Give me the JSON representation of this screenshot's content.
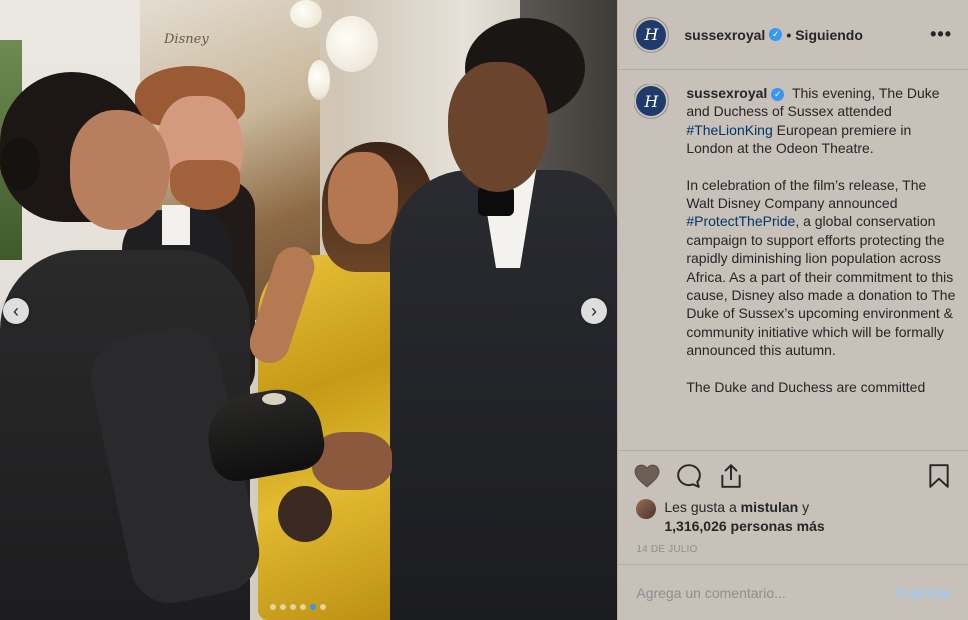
{
  "post": {
    "username": "sussexroyal",
    "follow_separator": "•",
    "follow_status": "Siguiendo",
    "more_label": "•••",
    "avatar_monogram": "H",
    "photo": {
      "poster_text": "Disney",
      "carousel_dots": 6,
      "carousel_active_index": 4,
      "prev_icon": "‹",
      "next_icon": "›"
    },
    "caption": {
      "username": "sussexroyal",
      "para1_before": " This evening, The Duke and Duchess of Sussex attended ",
      "hashtag1": "#TheLionKing",
      "para1_after": " European premiere in London at the Odeon Theatre.",
      "para2_before": "In celebration of the film’s release, The Walt Disney Company announced ",
      "hashtag2": "#ProtectThePride",
      "para2_after": ", a global conservation campaign to support efforts protecting the rapidly diminishing lion population across Africa. As a part of their commitment to this cause, Disney also made a donation to The Duke of Sussex’s upcoming environment & community initiative which will be formally announced this autumn.",
      "para3": "The Duke and Duchess are committed"
    },
    "actions": {
      "like_icon": "heart-icon",
      "comment_icon": "comment-icon",
      "share_icon": "share-icon",
      "save_icon": "bookmark-icon"
    },
    "likes": {
      "prefix": "Les gusta a ",
      "user": "mistulan",
      "connector": " y",
      "count": "1,316,026 personas más"
    },
    "date": "14 DE JULIO",
    "comment_input": {
      "placeholder": "Agrega un comentario..."
    },
    "publish_label": "Publicar",
    "colors": {
      "panel_bg": "#c7c1ba",
      "link": "#003569",
      "verified": "#3897f0",
      "publish_disabled": "#9fcaf3"
    }
  }
}
